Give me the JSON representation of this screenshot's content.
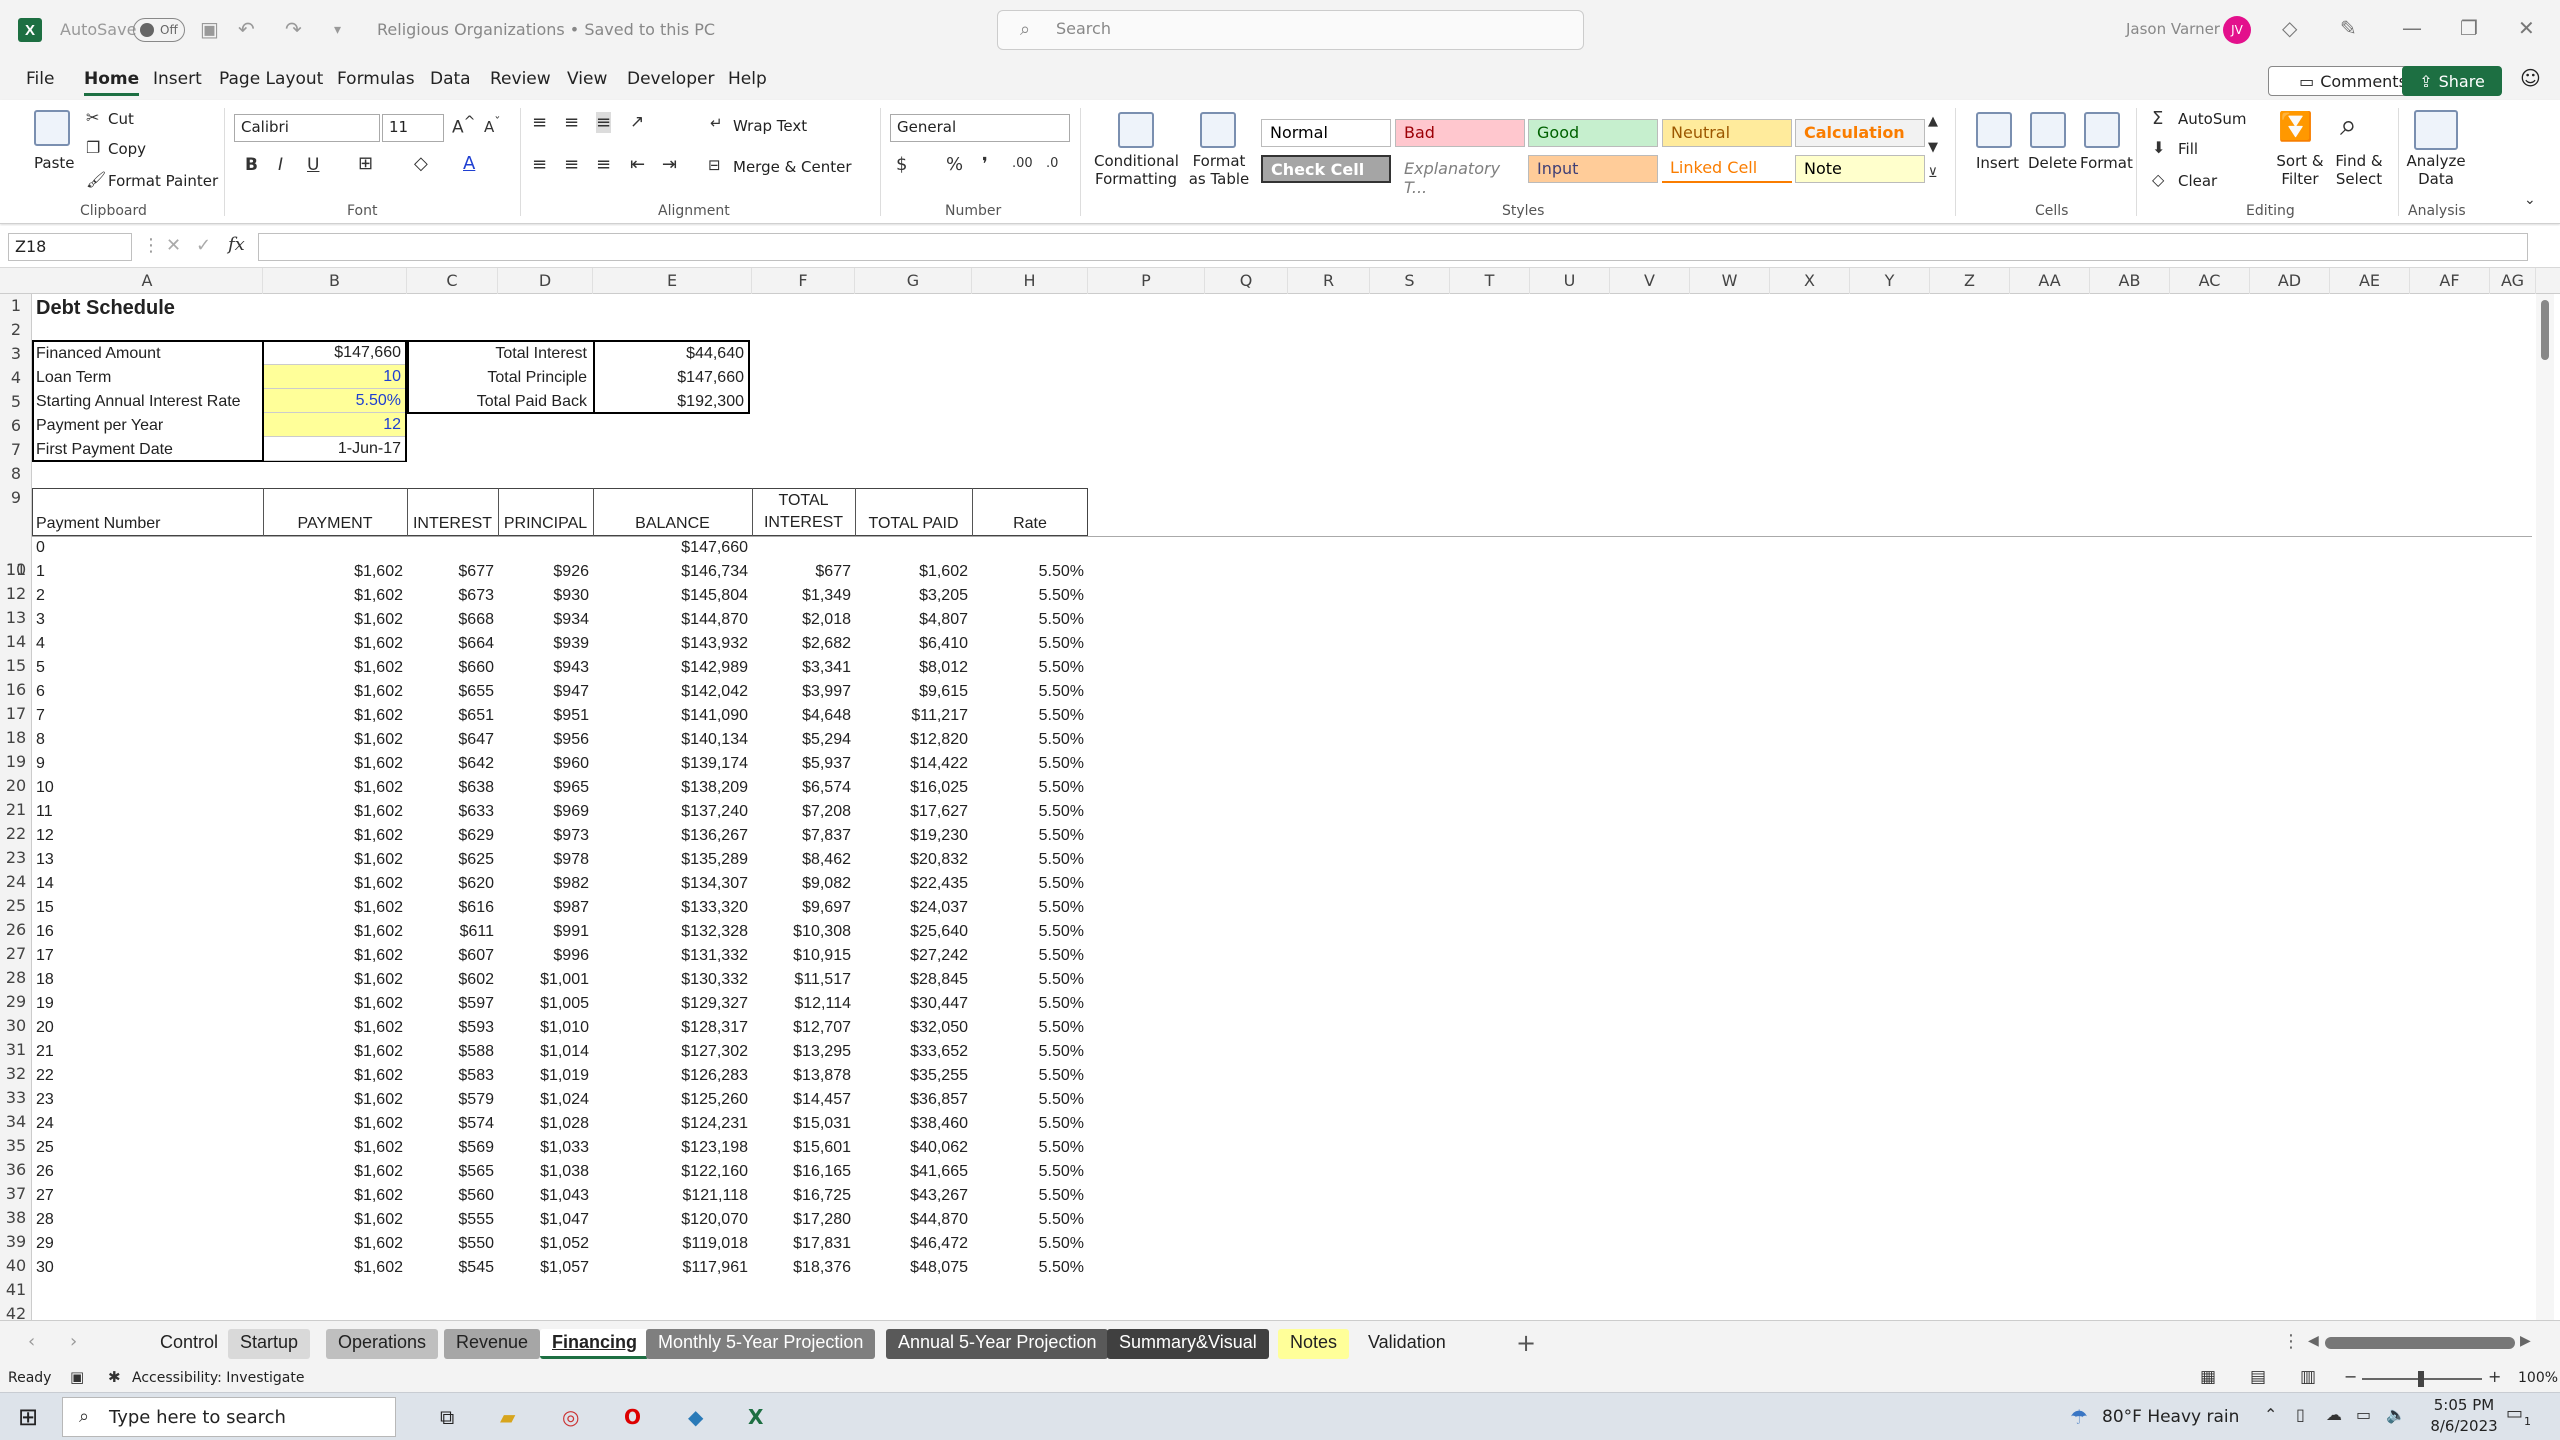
{
  "titlebar": {
    "autosave_label": "AutoSave",
    "autosave_state": "Off",
    "doc_title": "Religious Organizations • Saved to this PC",
    "search_placeholder": "Search",
    "user_name": "Jason Varner",
    "user_initials": "JV"
  },
  "menu": [
    "File",
    "Home",
    "Insert",
    "Page Layout",
    "Formulas",
    "Data",
    "Review",
    "View",
    "Developer",
    "Help"
  ],
  "menu_active": "Home",
  "comments_label": "Comments",
  "share_label": "Share",
  "ribbon": {
    "clipboard": {
      "paste": "Paste",
      "cut": "Cut",
      "copy": "Copy",
      "format_painter": "Format Painter",
      "label": "Clipboard"
    },
    "font": {
      "name": "Calibri",
      "size": "11",
      "label": "Font"
    },
    "alignment": {
      "wrap": "Wrap Text",
      "merge": "Merge & Center",
      "label": "Alignment"
    },
    "number": {
      "format": "General",
      "label": "Number"
    },
    "styles": {
      "conditional": "Conditional Formatting",
      "format_table": "Format as Table",
      "label": "Styles",
      "cells": [
        {
          "name": "Normal",
          "bg": "#ffffff",
          "fg": "#000000"
        },
        {
          "name": "Bad",
          "bg": "#ffc7ce",
          "fg": "#9c0006"
        },
        {
          "name": "Good",
          "bg": "#c6efce",
          "fg": "#006100"
        },
        {
          "name": "Neutral",
          "bg": "#ffeb9c",
          "fg": "#9c5700"
        },
        {
          "name": "Calculation",
          "bg": "#f2f2f2",
          "fg": "#fa7d00"
        },
        {
          "name": "Check Cell",
          "bg": "#a5a5a5",
          "fg": "#ffffff"
        },
        {
          "name": "Explanatory T...",
          "bg": "#ffffff",
          "fg": "#7f7f7f"
        },
        {
          "name": "Input",
          "bg": "#ffcc99",
          "fg": "#3f3f76"
        },
        {
          "name": "Linked Cell",
          "bg": "#ffffff",
          "fg": "#fa7d00"
        },
        {
          "name": "Note",
          "bg": "#ffffcc",
          "fg": "#000000"
        }
      ]
    },
    "cells": {
      "insert": "Insert",
      "delete": "Delete",
      "format": "Format",
      "label": "Cells"
    },
    "editing": {
      "autosum": "AutoSum",
      "fill": "Fill",
      "clear": "Clear",
      "sort": "Sort & Filter",
      "find": "Find & Select",
      "label": "Editing"
    },
    "analysis": {
      "analyze": "Analyze Data",
      "label": "Analysis"
    }
  },
  "formula_bar": {
    "name_box": "Z18",
    "fx": "fx",
    "value": ""
  },
  "columns": [
    "A",
    "B",
    "C",
    "D",
    "E",
    "F",
    "G",
    "H",
    "P",
    "Q",
    "R",
    "S",
    "T",
    "U",
    "V",
    "W",
    "X",
    "Y",
    "Z",
    "AA",
    "AB",
    "AC",
    "AD",
    "AE",
    "AF",
    "AG"
  ],
  "sheet": {
    "title": "Debt Schedule",
    "inputs": [
      {
        "label": "Financed Amount",
        "value": "$147,660"
      },
      {
        "label": "Loan Term",
        "value": "10"
      },
      {
        "label": "Starting Annual Interest Rate",
        "value": "5.50%"
      },
      {
        "label": "Payment per Year",
        "value": "12"
      },
      {
        "label": "First Payment Date",
        "value": "1-Jun-17"
      }
    ],
    "summary": [
      {
        "label": "Total Interest",
        "value": "$44,640"
      },
      {
        "label": "Total Principle",
        "value": "$147,660"
      },
      {
        "label": "Total Paid Back",
        "value": "$192,300"
      }
    ],
    "headers": [
      "Payment Number",
      "PAYMENT",
      "INTEREST",
      "PRINCIPAL",
      "BALANCE",
      "TOTAL INTEREST",
      "TOTAL PAID",
      "Rate"
    ],
    "row0": {
      "num": "0",
      "balance": "$147,660"
    },
    "rows": [
      [
        "1",
        "$1,602",
        "$677",
        "$926",
        "$146,734",
        "$677",
        "$1,602",
        "5.50%"
      ],
      [
        "2",
        "$1,602",
        "$673",
        "$930",
        "$145,804",
        "$1,349",
        "$3,205",
        "5.50%"
      ],
      [
        "3",
        "$1,602",
        "$668",
        "$934",
        "$144,870",
        "$2,018",
        "$4,807",
        "5.50%"
      ],
      [
        "4",
        "$1,602",
        "$664",
        "$939",
        "$143,932",
        "$2,682",
        "$6,410",
        "5.50%"
      ],
      [
        "5",
        "$1,602",
        "$660",
        "$943",
        "$142,989",
        "$3,341",
        "$8,012",
        "5.50%"
      ],
      [
        "6",
        "$1,602",
        "$655",
        "$947",
        "$142,042",
        "$3,997",
        "$9,615",
        "5.50%"
      ],
      [
        "7",
        "$1,602",
        "$651",
        "$951",
        "$141,090",
        "$4,648",
        "$11,217",
        "5.50%"
      ],
      [
        "8",
        "$1,602",
        "$647",
        "$956",
        "$140,134",
        "$5,294",
        "$12,820",
        "5.50%"
      ],
      [
        "9",
        "$1,602",
        "$642",
        "$960",
        "$139,174",
        "$5,937",
        "$14,422",
        "5.50%"
      ],
      [
        "10",
        "$1,602",
        "$638",
        "$965",
        "$138,209",
        "$6,574",
        "$16,025",
        "5.50%"
      ],
      [
        "11",
        "$1,602",
        "$633",
        "$969",
        "$137,240",
        "$7,208",
        "$17,627",
        "5.50%"
      ],
      [
        "12",
        "$1,602",
        "$629",
        "$973",
        "$136,267",
        "$7,837",
        "$19,230",
        "5.50%"
      ],
      [
        "13",
        "$1,602",
        "$625",
        "$978",
        "$135,289",
        "$8,462",
        "$20,832",
        "5.50%"
      ],
      [
        "14",
        "$1,602",
        "$620",
        "$982",
        "$134,307",
        "$9,082",
        "$22,435",
        "5.50%"
      ],
      [
        "15",
        "$1,602",
        "$616",
        "$987",
        "$133,320",
        "$9,697",
        "$24,037",
        "5.50%"
      ],
      [
        "16",
        "$1,602",
        "$611",
        "$991",
        "$132,328",
        "$10,308",
        "$25,640",
        "5.50%"
      ],
      [
        "17",
        "$1,602",
        "$607",
        "$996",
        "$131,332",
        "$10,915",
        "$27,242",
        "5.50%"
      ],
      [
        "18",
        "$1,602",
        "$602",
        "$1,001",
        "$130,332",
        "$11,517",
        "$28,845",
        "5.50%"
      ],
      [
        "19",
        "$1,602",
        "$597",
        "$1,005",
        "$129,327",
        "$12,114",
        "$30,447",
        "5.50%"
      ],
      [
        "20",
        "$1,602",
        "$593",
        "$1,010",
        "$128,317",
        "$12,707",
        "$32,050",
        "5.50%"
      ],
      [
        "21",
        "$1,602",
        "$588",
        "$1,014",
        "$127,302",
        "$13,295",
        "$33,652",
        "5.50%"
      ],
      [
        "22",
        "$1,602",
        "$583",
        "$1,019",
        "$126,283",
        "$13,878",
        "$35,255",
        "5.50%"
      ],
      [
        "23",
        "$1,602",
        "$579",
        "$1,024",
        "$125,260",
        "$14,457",
        "$36,857",
        "5.50%"
      ],
      [
        "24",
        "$1,602",
        "$574",
        "$1,028",
        "$124,231",
        "$15,031",
        "$38,460",
        "5.50%"
      ],
      [
        "25",
        "$1,602",
        "$569",
        "$1,033",
        "$123,198",
        "$15,601",
        "$40,062",
        "5.50%"
      ],
      [
        "26",
        "$1,602",
        "$565",
        "$1,038",
        "$122,160",
        "$16,165",
        "$41,665",
        "5.50%"
      ],
      [
        "27",
        "$1,602",
        "$560",
        "$1,043",
        "$121,118",
        "$16,725",
        "$43,267",
        "5.50%"
      ],
      [
        "28",
        "$1,602",
        "$555",
        "$1,047",
        "$120,070",
        "$17,280",
        "$44,870",
        "5.50%"
      ],
      [
        "29",
        "$1,602",
        "$550",
        "$1,052",
        "$119,018",
        "$17,831",
        "$46,472",
        "5.50%"
      ],
      [
        "30",
        "$1,602",
        "$545",
        "$1,057",
        "$117,961",
        "$18,376",
        "$48,075",
        "5.50%"
      ]
    ]
  },
  "tabs": [
    {
      "name": "Control",
      "bg": "#f3f3f3",
      "fg": "#222222"
    },
    {
      "name": "Startup",
      "bg": "#d9d9d9",
      "fg": "#222222"
    },
    {
      "name": "Operations",
      "bg": "#bfbfbf",
      "fg": "#222222"
    },
    {
      "name": "Revenue",
      "bg": "#a6a6a6",
      "fg": "#222222"
    },
    {
      "name": "Financing",
      "bg": "#ffffff",
      "fg": "#222222",
      "active": true
    },
    {
      "name": "Monthly 5-Year Projection",
      "bg": "#7f7f7f",
      "fg": "#ffffff"
    },
    {
      "name": "Annual 5-Year Projection",
      "bg": "#595959",
      "fg": "#ffffff"
    },
    {
      "name": "Summary&Visual",
      "bg": "#404040",
      "fg": "#ffffff"
    },
    {
      "name": "Notes",
      "bg": "#ffff99",
      "fg": "#222222"
    },
    {
      "name": "Validation",
      "bg": "#f3f3f3",
      "fg": "#222222"
    }
  ],
  "status": {
    "ready": "Ready",
    "accessibility": "Accessibility: Investigate",
    "zoom": "100%"
  },
  "taskbar": {
    "search_placeholder": "Type here to search",
    "weather": "80°F  Heavy rain",
    "time": "5:05 PM",
    "date": "8/6/2023",
    "notif": "1"
  },
  "colors": {
    "excel_green": "#1d6f42",
    "input_fill": "#ffff99",
    "input_blue": "#1f3fd1"
  }
}
